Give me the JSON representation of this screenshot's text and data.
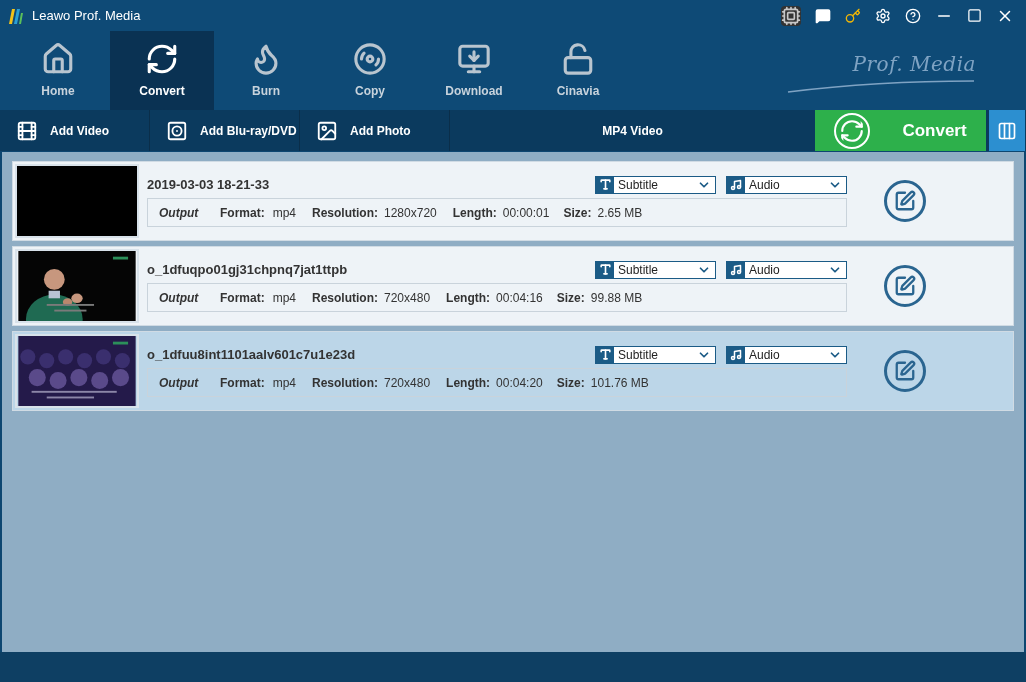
{
  "window": {
    "title": "Leawo Prof. Media"
  },
  "nav": [
    {
      "kind": "home",
      "label": "Home",
      "selected": false
    },
    {
      "kind": "convert",
      "label": "Convert",
      "selected": true
    },
    {
      "kind": "burn",
      "label": "Burn",
      "selected": false
    },
    {
      "kind": "copy",
      "label": "Copy",
      "selected": false
    },
    {
      "kind": "download",
      "label": "Download",
      "selected": false
    },
    {
      "kind": "cinavia",
      "label": "Cinavia",
      "selected": false
    }
  ],
  "logo_text": "Prof. Media",
  "toolbar": {
    "buttons": [
      {
        "kind": "video",
        "label": "Add Video"
      },
      {
        "kind": "disc",
        "label": "Add Blu-ray/DVD"
      },
      {
        "label": "Add Photo"
      }
    ],
    "profile": "MP4 Video",
    "convert": "Convert"
  },
  "files": [
    {
      "name": "2019-03-03 18-21-33",
      "thumbnail": {
        "kind": "blank"
      },
      "selected": false,
      "output": "Output",
      "format_label": "Format:",
      "format": "mp4",
      "resolution_label": "Resolution:",
      "resolution": "1280x720",
      "length_label": "Length:",
      "length": "00:00:01",
      "size_label": "Size:",
      "size": "2.65 MB",
      "subtitle": "Subtitle",
      "audio": "Audio"
    },
    {
      "name": "o_1dfuqpo01gj31chpnq7jat1ttpb",
      "thumbnail": {
        "kind": "speaker"
      },
      "selected": false,
      "output": "Output",
      "format_label": "Format:",
      "format": "mp4",
      "resolution_label": "Resolution:",
      "resolution": "720x480",
      "length_label": "Length:",
      "length": "00:04:16",
      "size_label": "Size:",
      "size": "99.88 MB",
      "subtitle": "Subtitle",
      "audio": "Audio"
    },
    {
      "name": "o_1dfuu8int1101aalv601c7u1e23d",
      "thumbnail": {
        "kind": "crowd"
      },
      "selected": true,
      "output": "Output",
      "format_label": "Format:",
      "format": "mp4",
      "resolution_label": "Resolution:",
      "resolution": "720x480",
      "length_label": "Length:",
      "length": "00:04:20",
      "size_label": "Size:",
      "size": "101.76 MB",
      "subtitle": "Subtitle",
      "audio": "Audio"
    }
  ]
}
